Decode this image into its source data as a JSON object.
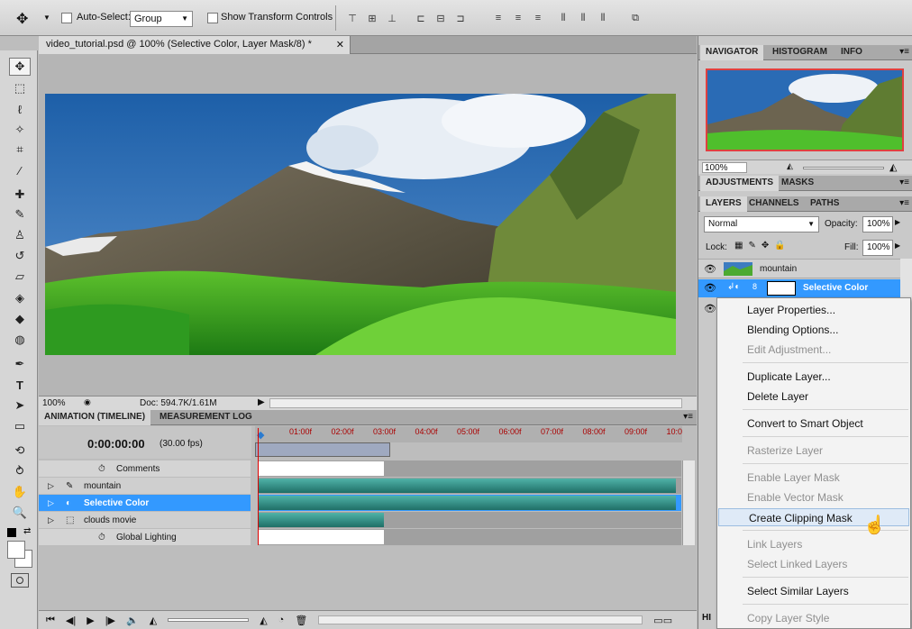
{
  "options": {
    "auto_select_label": "Auto-Select:",
    "auto_select_value": "Group",
    "show_transform_label": "Show Transform Controls"
  },
  "document": {
    "tab_title": "video_tutorial.psd @ 100% (Selective Color, Layer Mask/8) *",
    "zoom": "100%",
    "doc_size": "Doc: 594.7K/1.61M"
  },
  "animation": {
    "tab_active": "ANIMATION (TIMELINE)",
    "tab_other": "MEASUREMENT LOG",
    "timecode": "0:00:00:00",
    "fps": "(30.00 fps)",
    "ruler": [
      "01:00f",
      "02:00f",
      "03:00f",
      "04:00f",
      "05:00f",
      "06:00f",
      "07:00f",
      "08:00f",
      "09:00f",
      "10:0"
    ],
    "rows": [
      "Comments",
      "mountain",
      "Selective Color",
      "clouds movie",
      "Global Lighting"
    ]
  },
  "navigator": {
    "tabs": [
      "NAVIGATOR",
      "HISTOGRAM",
      "INFO"
    ],
    "zoom": "100%"
  },
  "adjustments": {
    "tabs": [
      "ADJUSTMENTS",
      "MASKS"
    ]
  },
  "layers": {
    "tabs": [
      "LAYERS",
      "CHANNELS",
      "PATHS"
    ],
    "blend_mode": "Normal",
    "opacity_label": "Opacity:",
    "opacity": "100%",
    "lock_label": "Lock:",
    "fill_label": "Fill:",
    "fill": "100%",
    "items": [
      "mountain",
      "Selective Color"
    ],
    "bottom_label": "HI"
  },
  "context_menu": {
    "items": [
      {
        "label": "Layer Properties...",
        "state": "enabled"
      },
      {
        "label": "Blending Options...",
        "state": "enabled"
      },
      {
        "label": "Edit Adjustment...",
        "state": "disabled"
      },
      {
        "label": "Duplicate Layer...",
        "state": "enabled"
      },
      {
        "label": "Delete Layer",
        "state": "enabled"
      },
      {
        "label": "Convert to Smart Object",
        "state": "enabled"
      },
      {
        "label": "Rasterize Layer",
        "state": "disabled"
      },
      {
        "label": "Enable Layer Mask",
        "state": "disabled"
      },
      {
        "label": "Enable Vector Mask",
        "state": "disabled"
      },
      {
        "label": "Create Clipping Mask",
        "state": "highlighted"
      },
      {
        "label": "Link Layers",
        "state": "disabled"
      },
      {
        "label": "Select Linked Layers",
        "state": "disabled"
      },
      {
        "label": "Select Similar Layers",
        "state": "enabled"
      },
      {
        "label": "Copy Layer Style",
        "state": "disabled"
      }
    ]
  },
  "colors": {
    "selection": "#3399ff",
    "track_teal": "#2f8f86",
    "ruler_text": "#aa0000"
  }
}
